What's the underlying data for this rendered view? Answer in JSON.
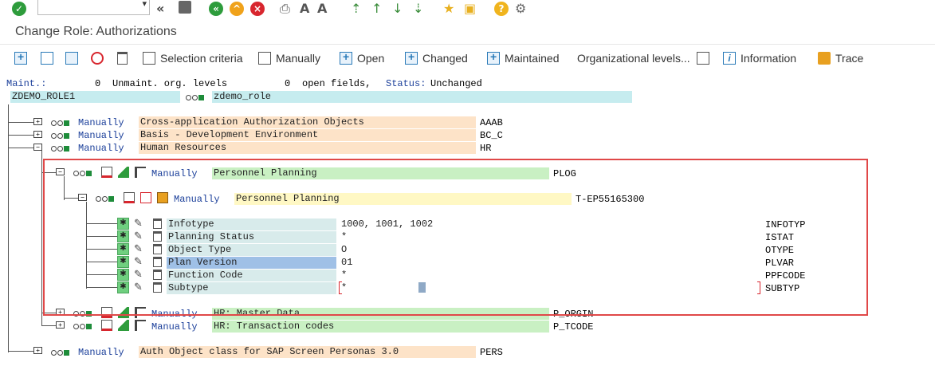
{
  "toolbar_top": {
    "command_value": "",
    "icons": [
      "enter-icon",
      "back-icon",
      "save-icon",
      "back-green-icon",
      "exit-icon",
      "cancel-icon",
      "print-icon",
      "find-icon",
      "find-next-icon",
      "first-page-icon",
      "prev-page-icon",
      "next-page-icon",
      "last-page-icon",
      "new-session-icon",
      "shortcut-icon",
      "help-icon",
      "settings-icon"
    ]
  },
  "title": "Change Role: Authorizations",
  "app_toolbar": {
    "selection_criteria": "Selection criteria",
    "manually": "Manually",
    "open": "Open",
    "changed": "Changed",
    "maintained": "Maintained",
    "org_levels": "Organizational levels...",
    "information": "Information",
    "trace": "Trace"
  },
  "summary": {
    "maint_label": "Maint.:",
    "maint_value": "0",
    "unmaint_label": "Unmaint. org. levels",
    "unmaint_value": "0",
    "open_fields_label": "open fields,",
    "status_label": "Status:",
    "status_value": "Unchanged"
  },
  "role": {
    "name": "ZDEMO_ROLE1",
    "description": "zdemo_role"
  },
  "tree": {
    "level1": [
      {
        "mode": "Manually",
        "text": "Cross-application Authorization Objects",
        "code": "AAAB"
      },
      {
        "mode": "Manually",
        "text": "Basis - Development Environment",
        "code": "BC_C"
      },
      {
        "mode": "Manually",
        "text": "Human Resources",
        "code": "HR"
      }
    ],
    "plog": {
      "mode": "Manually",
      "text": "Personnel Planning",
      "code": "PLOG"
    },
    "object": {
      "mode": "Manually",
      "text": "Personnel Planning",
      "code": "T-EP55165300"
    },
    "fields": [
      {
        "label": "Infotype",
        "value": "1000, 1001, 1002",
        "code": "INFOTYP"
      },
      {
        "label": "Planning Status",
        "value": "*",
        "code": "ISTAT"
      },
      {
        "label": "Object Type",
        "value": "O",
        "code": "OTYPE"
      },
      {
        "label": "Plan Version",
        "value": "01",
        "code": "PLVAR"
      },
      {
        "label": "Function Code",
        "value": "*",
        "code": "PPFCODE"
      },
      {
        "label": "Subtype",
        "value": "*",
        "code": "SUBTYP"
      }
    ],
    "hr_master": {
      "mode": "Manually",
      "text": "HR: Master Data",
      "code": "P_ORGIN"
    },
    "hr_tcodes": {
      "mode": "Manually",
      "text": "HR: Transaction codes",
      "code": "P_TCODE"
    },
    "pers": {
      "mode": "Manually",
      "text": "Auth Object class for SAP Screen Personas 3.0",
      "code": "PERS"
    }
  },
  "colors": {
    "highlight": "#e04848",
    "status_green": "#1e8c3a",
    "link_blue": "#1b3f9a"
  }
}
